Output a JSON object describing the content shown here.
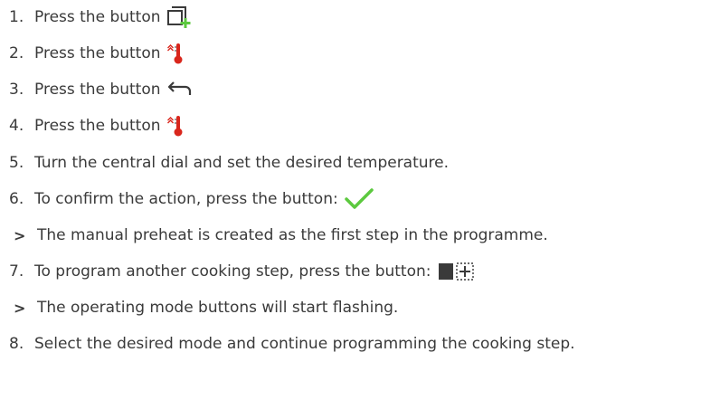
{
  "steps": [
    {
      "marker": "1.",
      "text": "Press the button",
      "icon": "add-step-icon"
    },
    {
      "marker": "2.",
      "text": "Press the button",
      "icon": "preheat-thermometer-icon"
    },
    {
      "marker": "3.",
      "text": "Press the button",
      "icon": "back-arrow-icon"
    },
    {
      "marker": "4.",
      "text": "Press the button",
      "icon": "preheat-thermometer-icon"
    },
    {
      "marker": "5.",
      "text": "Turn the central dial and set the desired temperature.",
      "icon": ""
    },
    {
      "marker": "6.",
      "text": "To confirm the action, press the button:",
      "icon": "checkmark-icon"
    },
    {
      "marker": ">",
      "text": "The manual preheat is created as the first step in the programme.",
      "icon": ""
    },
    {
      "marker": "7.",
      "text": "To program another cooking step, press the button:",
      "icon": "add-cooking-step-icon"
    },
    {
      "marker": ">",
      "text": "The operating mode buttons will start flashing.",
      "icon": ""
    },
    {
      "marker": "8.",
      "text": "Select the desired mode and continue programming the cooking step.",
      "icon": ""
    }
  ],
  "colors": {
    "text": "#3a3a3a",
    "accent_green": "#5cc93f",
    "accent_red": "#d9261c",
    "icon_dark": "#3a3a3a"
  }
}
